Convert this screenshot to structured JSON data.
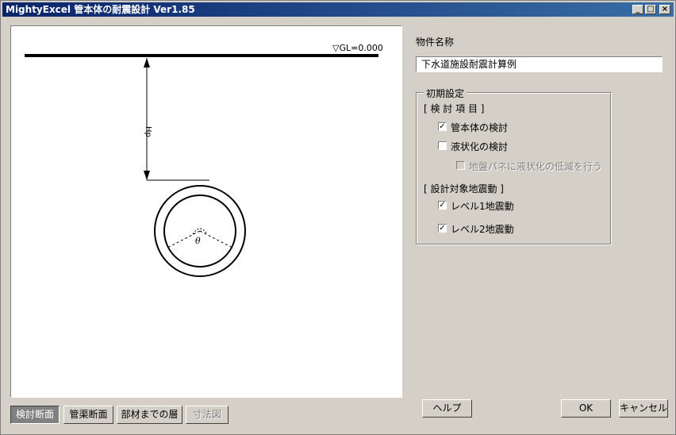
{
  "window": {
    "title": "MightyExcel 管本体の耐震設計 Ver1.85",
    "controls": {
      "minimize": "_",
      "maximize": "□",
      "close": "×"
    }
  },
  "drawing": {
    "gl_label": "▽GL=0.000",
    "depth_label": "Hp",
    "angle_label": "θ"
  },
  "property": {
    "label": "物件名称",
    "value": "下水道施設耐震計算例"
  },
  "settings": {
    "legend": "初期設定",
    "items_heading": "[ 検 討 項 目 ]",
    "check_pipe": {
      "label": "管本体の検討",
      "checked": true
    },
    "check_liquefaction": {
      "label": "液状化の検討",
      "checked": false
    },
    "check_reduce": {
      "label": "地盤バネに液状化の低減を行う",
      "checked": false,
      "enabled": false
    },
    "motion_heading": "[ 設計対象地震動 ]",
    "check_level1": {
      "label": "レベル1地震動",
      "checked": true
    },
    "check_level2": {
      "label": "レベル2地震動",
      "checked": true
    },
    "check_mark": "✓"
  },
  "tabs": {
    "cross_section": "検討断面",
    "pipe_section": "管渠断面",
    "layers": "部材までの層",
    "dimensions": "寸法図"
  },
  "buttons": {
    "help": "ヘルプ",
    "ok": "OK",
    "cancel": "キャンセル"
  }
}
